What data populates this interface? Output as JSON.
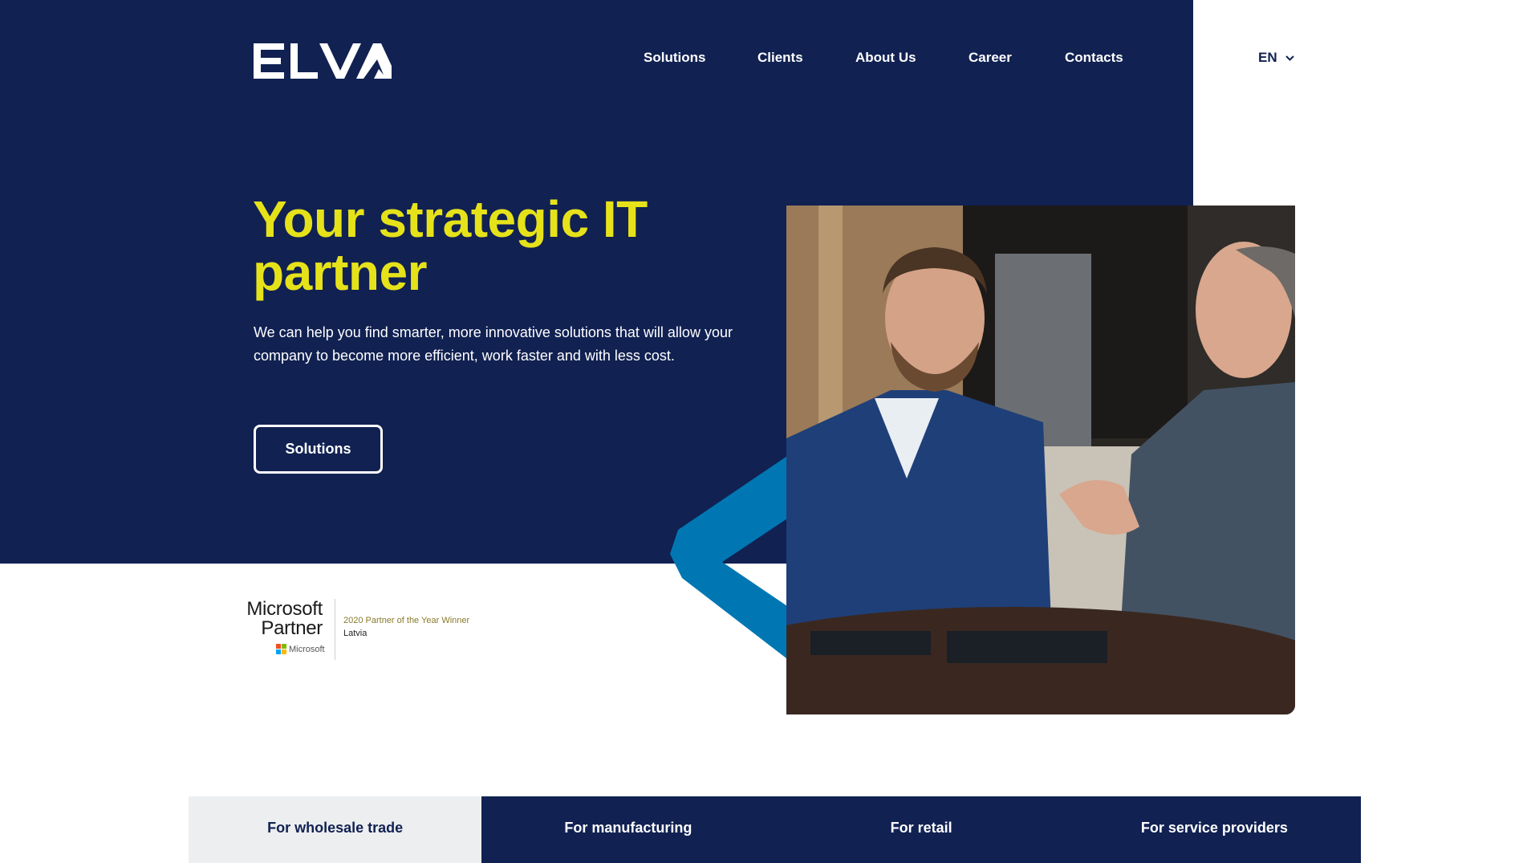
{
  "brand": {
    "logo_text": "ELVA",
    "navy": "#112152",
    "yellow": "#e6e21a",
    "blue": "#0077b3"
  },
  "nav": {
    "items": [
      {
        "label": "Solutions"
      },
      {
        "label": "Clients"
      },
      {
        "label": "About Us"
      },
      {
        "label": "Career"
      },
      {
        "label": "Contacts"
      }
    ]
  },
  "language": {
    "current": "EN",
    "icon": "chevron-down-icon"
  },
  "hero": {
    "title": "Your strategic IT partner",
    "subtitle": "We can help you find smarter, more innovative solutions that will allow your company to become more efficient, work faster and with less cost.",
    "cta_label": "Solutions"
  },
  "partner_badge": {
    "line1": "Microsoft",
    "line2": "Partner",
    "brand_small": "Microsoft",
    "award": "2020 Partner of the Year Winner",
    "country": "Latvia"
  },
  "tabs": [
    {
      "label": "For wholesale trade",
      "active": true
    },
    {
      "label": "For manufacturing",
      "active": false
    },
    {
      "label": "For retail",
      "active": false
    },
    {
      "label": "For service providers",
      "active": false
    }
  ]
}
